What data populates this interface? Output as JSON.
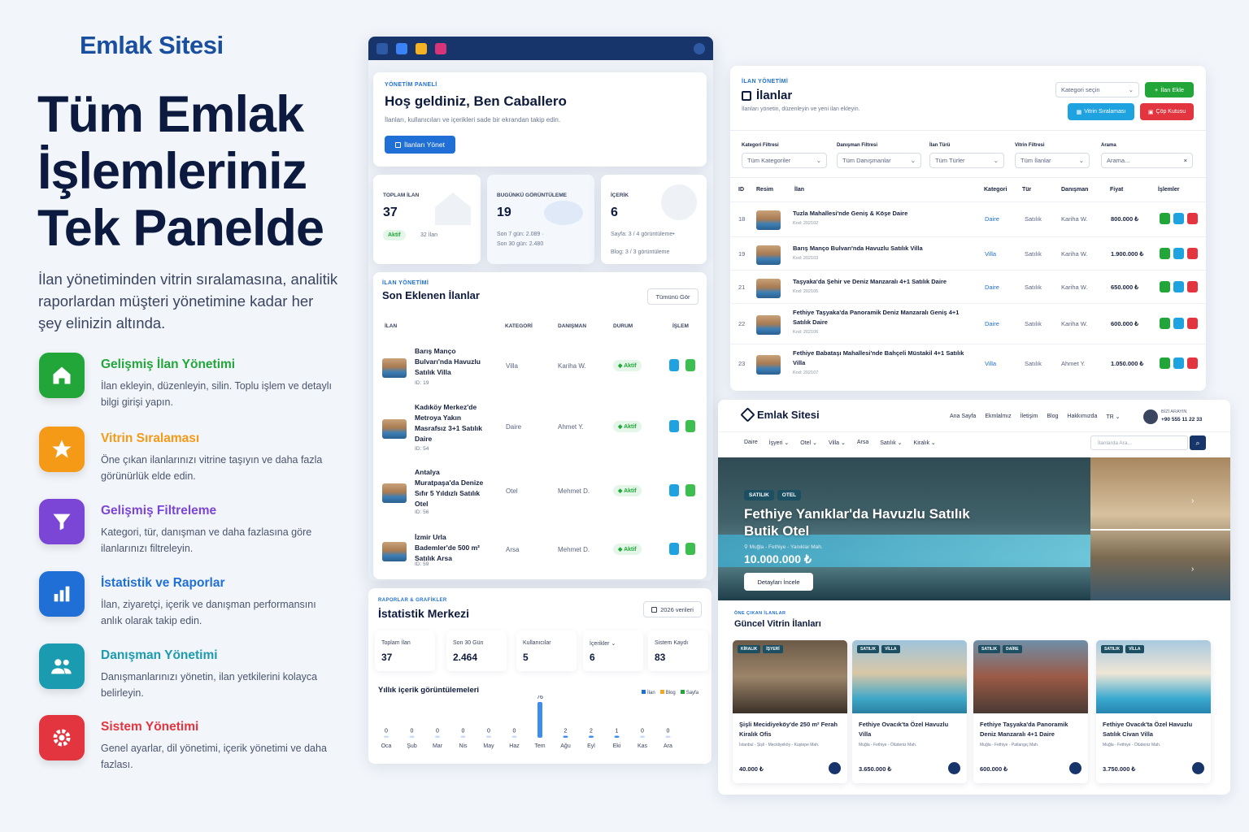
{
  "left": {
    "brand": "Emlak Sitesi",
    "hero_lines": [
      "Tüm Emlak",
      "İşlemleriniz",
      "Tek Panelde"
    ],
    "lead": "İlan yönetiminden vitrin sıralamasına, analitik raporlardan müşteri yönetimine kadar her şey elinizin altında.",
    "features": [
      {
        "title": "Gelişmiş İlan Yönetimi",
        "desc": "İlan ekleyin, düzenleyin, silin. Toplu işlem ve detaylı bilgi girişi yapın.",
        "color": "#22a63a",
        "icon": "home-icon"
      },
      {
        "title": "Vitrin Sıralaması",
        "desc": "Öne çıkan ilanlarınızı vitrine taşıyın ve daha fazla görünürlük elde edin.",
        "color": "#f59a16",
        "icon": "star-icon"
      },
      {
        "title": "Gelişmiş Filtreleme",
        "desc": "Kategori, tür, danışman ve daha fazlasına göre ilanlarınızı filtreleyin.",
        "color": "#7b45d6",
        "icon": "filter-icon"
      },
      {
        "title": "İstatistik ve Raporlar",
        "desc": "İlan, ziyaretçi, içerik ve danışman performansını anlık olarak takip edin.",
        "color": "#1f6fd6",
        "icon": "bar-chart-icon"
      },
      {
        "title": "Danışman Yönetimi",
        "desc": "Danışmanlarınızı yönetin, ilan yetkilerini kolayca belirleyin.",
        "color": "#1a9bb0",
        "icon": "users-icon"
      },
      {
        "title": "Sistem Yönetimi",
        "desc": "Genel ayarlar, dil yönetimi, içerik yönetimi ve daha fazlası.",
        "color": "#e2353f",
        "icon": "gear-icon"
      }
    ]
  },
  "dashboard": {
    "panel_label": "YÖNETİM PANELİ",
    "welcome": "Hoş geldiniz, Ben Caballero",
    "subtitle": "İlanları, kullanıcıları ve içerikleri sade bir ekrandan takip edin.",
    "manage_button": "İlanları Yönet",
    "stats": [
      {
        "label": "TOPLAM İLAN",
        "value": "37",
        "badge": "Aktif",
        "extra": "32 İlan"
      },
      {
        "label": "BUGÜNKÜ GÖRÜNTÜLEME",
        "value": "19",
        "line1": "Son 7 gün: 2.089 ·",
        "line2": "Son 30 gün: 2.480"
      },
      {
        "label": "İÇERİK",
        "value": "6",
        "line1": "Sayfa: 3 / 4 görüntüleme•",
        "line2": "Blog: 3 / 3 görüntüleme"
      }
    ],
    "recent_label": "İLAN YÖNETİMİ",
    "recent_title": "Son Eklenen İlanlar",
    "see_all": "Tümünü Gör",
    "columns": [
      "İLAN",
      "KATEGORİ",
      "DANIŞMAN",
      "DURUM",
      "İŞLEM"
    ],
    "rows": [
      {
        "title": "Barış Manço Bulvarı'nda Havuzlu Satılık Villa",
        "id": "ID: 19",
        "category": "Villa",
        "agent": "Kariha W.",
        "status": "Aktif"
      },
      {
        "title": "Kadıköy Merkez'de Metroya Yakın Masrafsız 3+1 Satılık Daire",
        "id": "ID: 54",
        "category": "Daire",
        "agent": "Ahmet Y.",
        "status": "Aktif"
      },
      {
        "title": "Antalya Muratpaşa'da Denize Sıfır 5 Yıldızlı Satılık Otel",
        "id": "ID: 56",
        "category": "Otel",
        "agent": "Mehmet D.",
        "status": "Aktif"
      },
      {
        "title": "İzmir Urla Bademler'de 500 m² Satılık Arsa",
        "id": "ID: 59",
        "category": "Arsa",
        "agent": "Mehmet D.",
        "status": "Aktif"
      }
    ]
  },
  "stats_center": {
    "label": "RAPORLAR & GRAFİKLER",
    "title": "İstatistik Merkezi",
    "year_button": "2026 verileri",
    "kpis": [
      {
        "label": "Toplam İlan",
        "value": "37"
      },
      {
        "label": "Son 30 Gün",
        "value": "2.464"
      },
      {
        "label": "Kullanıcılar",
        "value": "5"
      },
      {
        "label": "İçerikler ⌄",
        "value": "6"
      },
      {
        "label": "Sistem Kaydı",
        "value": "83"
      }
    ],
    "chart_title": "Yıllık içerik görüntülemeleri",
    "legend": [
      {
        "name": "İlan",
        "color": "#1f6fd6"
      },
      {
        "name": "Blog",
        "color": "#f5a623"
      },
      {
        "name": "Sayfa",
        "color": "#22a63a"
      }
    ]
  },
  "chart_data": {
    "type": "bar",
    "title": "Yıllık içerik görüntülemeleri",
    "categories": [
      "Oca",
      "Şub",
      "Mar",
      "Nis",
      "May",
      "Haz",
      "Tem",
      "Ağu",
      "Eyl",
      "Eki",
      "Kas",
      "Ara"
    ],
    "values": [
      0,
      0,
      0,
      0,
      0,
      0,
      76,
      2,
      2,
      1,
      0,
      0
    ],
    "ylim": [
      0,
      76
    ],
    "grid": false,
    "legend_position": "top-right"
  },
  "listings": {
    "label": "İLAN YÖNETİMİ",
    "title": "İlanlar",
    "subtitle": "İlanları yönetin, düzenleyin ve yeni ilan ekleyin.",
    "category_select": "Kategori seçin",
    "add_button": "İlan Ekle",
    "showcase_button": "Vitrin Sıralaması",
    "trash_button": "Çöp Kutusu",
    "filters": [
      {
        "label": "Kategori Filtresi",
        "value": "Tüm Kategoriler"
      },
      {
        "label": "Danışman Filtresi",
        "value": "Tüm Danışmanlar"
      },
      {
        "label": "İlan Türü",
        "value": "Tüm Türler"
      },
      {
        "label": "Vitrin Filtresi",
        "value": "Tüm İlanlar"
      }
    ],
    "search_label": "Arama",
    "search_placeholder": "Arama...",
    "columns": [
      "ID",
      "Resim",
      "İlan",
      "Kategori",
      "Tür",
      "Danışman",
      "Fiyat",
      "İşlemler"
    ],
    "rows": [
      {
        "id": "18",
        "title": "Tuzla Mahallesi'nde Geniş & Köşe Daire",
        "code": "Kod: 202102",
        "category": "Daire",
        "type": "Satılık",
        "agent": "Kariha W.",
        "price": "800.000 ₺"
      },
      {
        "id": "19",
        "title": "Barış Manço Bulvarı'nda Havuzlu Satılık Villa",
        "code": "Kod: 202103",
        "category": "Villa",
        "type": "Satılık",
        "agent": "Kariha W.",
        "price": "1.900.000 ₺"
      },
      {
        "id": "21",
        "title": "Taşyaka'da Şehir ve Deniz Manzaralı 4+1 Satılık Daire",
        "code": "Kod: 202105",
        "category": "Daire",
        "type": "Satılık",
        "agent": "Kariha W.",
        "price": "650.000 ₺"
      },
      {
        "id": "22",
        "title": "Fethiye Taşyaka'da Panoramik Deniz Manzaralı Geniş 4+1 Satılık Daire",
        "code": "Kod: 202106",
        "category": "Daire",
        "type": "Satılık",
        "agent": "Kariha W.",
        "price": "600.000 ₺"
      },
      {
        "id": "23",
        "title": "Fethiye Babataşı Mahallesi'nde Bahçeli Müstakil 4+1 Satılık Villa",
        "code": "Kod: 202107",
        "category": "Villa",
        "type": "Satılık",
        "agent": "Ahmet Y.",
        "price": "1.050.000 ₺"
      }
    ]
  },
  "site": {
    "brand": "Emlak Sitesi",
    "nav": [
      "Ana Sayfa",
      "Ekmlalmız",
      "İletişim",
      "Blog",
      "Hakkımızda",
      "TR ⌄"
    ],
    "contact_label": "BİZİ ARAYIN",
    "contact_phone": "+90 555 11 22 33",
    "categories": [
      "Daire",
      "İşyeri ⌄",
      "Otel ⌄",
      "Villa ⌄",
      "Arsa",
      "Satılık ⌄",
      "Kiralık ⌄"
    ],
    "search_placeholder": "İlanlarda Ara...",
    "hero_tags": [
      "SATILIK",
      "OTEL"
    ],
    "hero_title": "Fethiye Yanıklar'da Havuzlu Satılık Butik Otel",
    "hero_location": "Muğla - Fethiye - Yanıklar Mah.",
    "hero_price": "10.000.000 ₺",
    "hero_button": "Detayları İncele",
    "featured_label": "ÖNE ÇIKAN İLANLAR",
    "featured_title": "Güncel Vitrin İlanları",
    "cards": [
      {
        "tags": [
          "KİRALIK",
          "İŞYERİ"
        ],
        "title": "Şişli Mecidiyeköy'de 250 m² Ferah Kiralık Ofis",
        "location": "İstanbul - Şişli - Mecidiyeköy - Kuştepe Mah.",
        "price": "40.000 ₺"
      },
      {
        "tags": [
          "SATILIK",
          "VİLLA"
        ],
        "title": "Fethiye Ovacık'ta Özel Havuzlu Villa",
        "location": "Muğla - Fethiye - Ölüdeniz Mah.",
        "price": "3.650.000 ₺"
      },
      {
        "tags": [
          "SATILIK",
          "DAİRE"
        ],
        "title": "Fethiye Taşyaka'da Panoramik Deniz Manzaralı 4+1 Daire",
        "location": "Muğla - Fethiye - Patlangıç Mah.",
        "price": "600.000 ₺"
      },
      {
        "tags": [
          "SATILIK",
          "VİLLA"
        ],
        "title": "Fethiye Ovacık'ta Özel Havuzlu Satılık Civan Villa",
        "location": "Muğla - Fethiye - Ölüdeniz Mah.",
        "price": "3.750.000 ₺"
      }
    ]
  }
}
